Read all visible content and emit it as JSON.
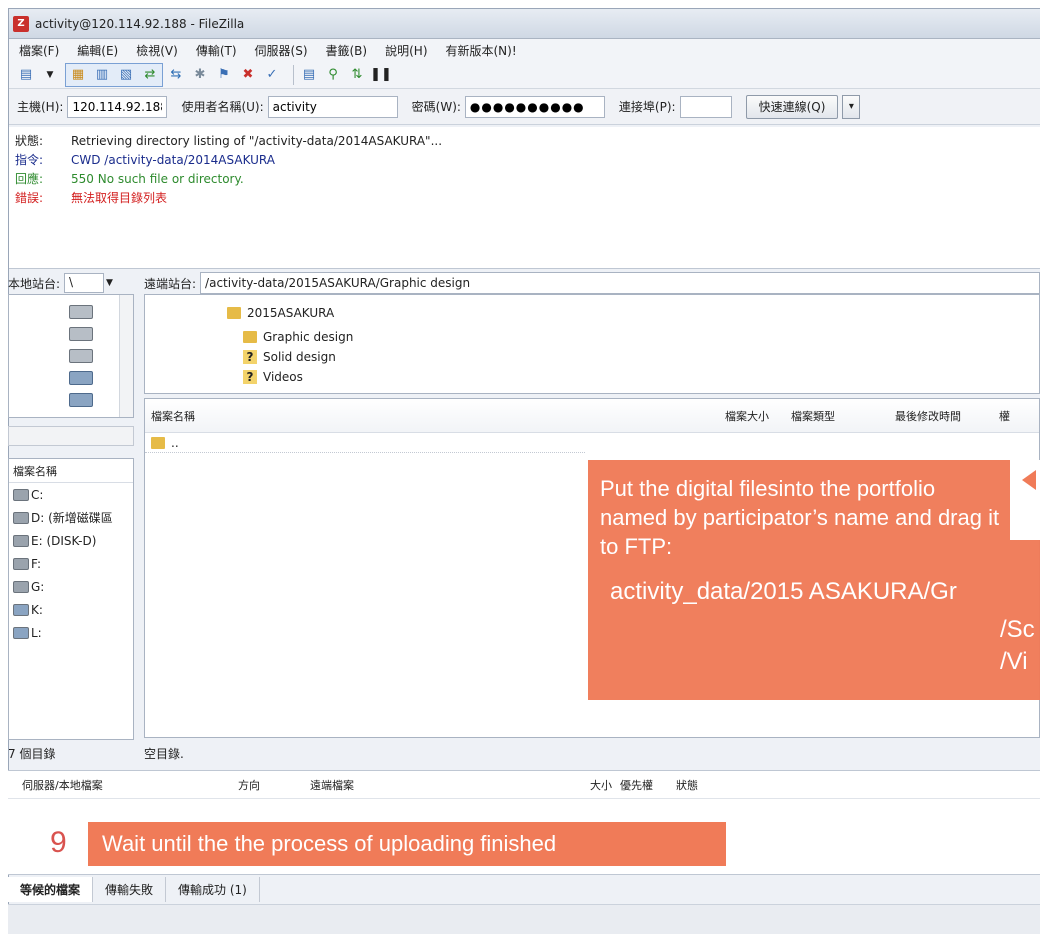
{
  "window": {
    "title": "activity@120.114.92.188 - FileZilla",
    "app_icon": "Z"
  },
  "menu": [
    "檔案(F)",
    "編輯(E)",
    "檢視(V)",
    "傳輸(T)",
    "伺服器(S)",
    "書籤(B)",
    "說明(H)",
    "有新版本(N)!"
  ],
  "quickconnect": {
    "host_label": "主機(H):",
    "host_value": "120.114.92.188",
    "user_label": "使用者名稱(U):",
    "user_value": "activity",
    "pass_label": "密碼(W):",
    "pass_value": "●●●●●●●●●●",
    "port_label": "連接埠(P):",
    "port_value": "",
    "connect_label": "快速連線(Q)",
    "dropdown_glyph": "▾"
  },
  "log": [
    {
      "key": "狀態:",
      "text": "Retrieving directory listing of \"/activity-data/2014ASAKURA\"...",
      "color": "#222222"
    },
    {
      "key": "指令:",
      "text": "CWD /activity-data/2014ASAKURA",
      "color": "#1a2c8c"
    },
    {
      "key": "回應:",
      "text": "550 No such file or directory.",
      "color": "#2e8b2e"
    },
    {
      "key": "錯誤:",
      "text": "無法取得目錄列表",
      "color": "#d32020"
    }
  ],
  "local": {
    "site_label": "本地站台:",
    "site_value": "\\",
    "files_header": "檔案名稱",
    "drives": [
      "C:",
      "D: (新增磁碟區",
      "E: (DISK-D)",
      "F:",
      "G:",
      "K:",
      "L:"
    ],
    "status": "7 個目錄"
  },
  "remote": {
    "site_label": "遠端站台:",
    "site_value": "/activity-data/2015ASAKURA/Graphic design",
    "tree_root": "2015ASAKURA",
    "tree_children": [
      "Graphic design",
      "Solid design",
      "Videos"
    ],
    "columns": [
      "檔案名稱",
      "檔案大小",
      "檔案類型",
      "最後修改時間",
      "權"
    ],
    "parent_row": "..",
    "status": "空目錄."
  },
  "queue": {
    "columns": [
      "伺服器/本地檔案",
      "方向",
      "遠端檔案",
      "大小",
      "優先權",
      "狀態"
    ],
    "tabs": [
      "等候的檔案",
      "傳輸失敗",
      "傳輸成功 (1)"
    ]
  },
  "annotation": {
    "callout_text": "Put the digital filesinto the portfolio named by participator’s name and drag it to FTP:",
    "path_main": "activity_data/2015 ASAKURA/Gr",
    "path_sub1": "/Sc",
    "path_sub2": "/Vi",
    "step_number": "9",
    "step_text": "Wait until the the process of uploading finished",
    "accent_color": "#f07b58"
  }
}
